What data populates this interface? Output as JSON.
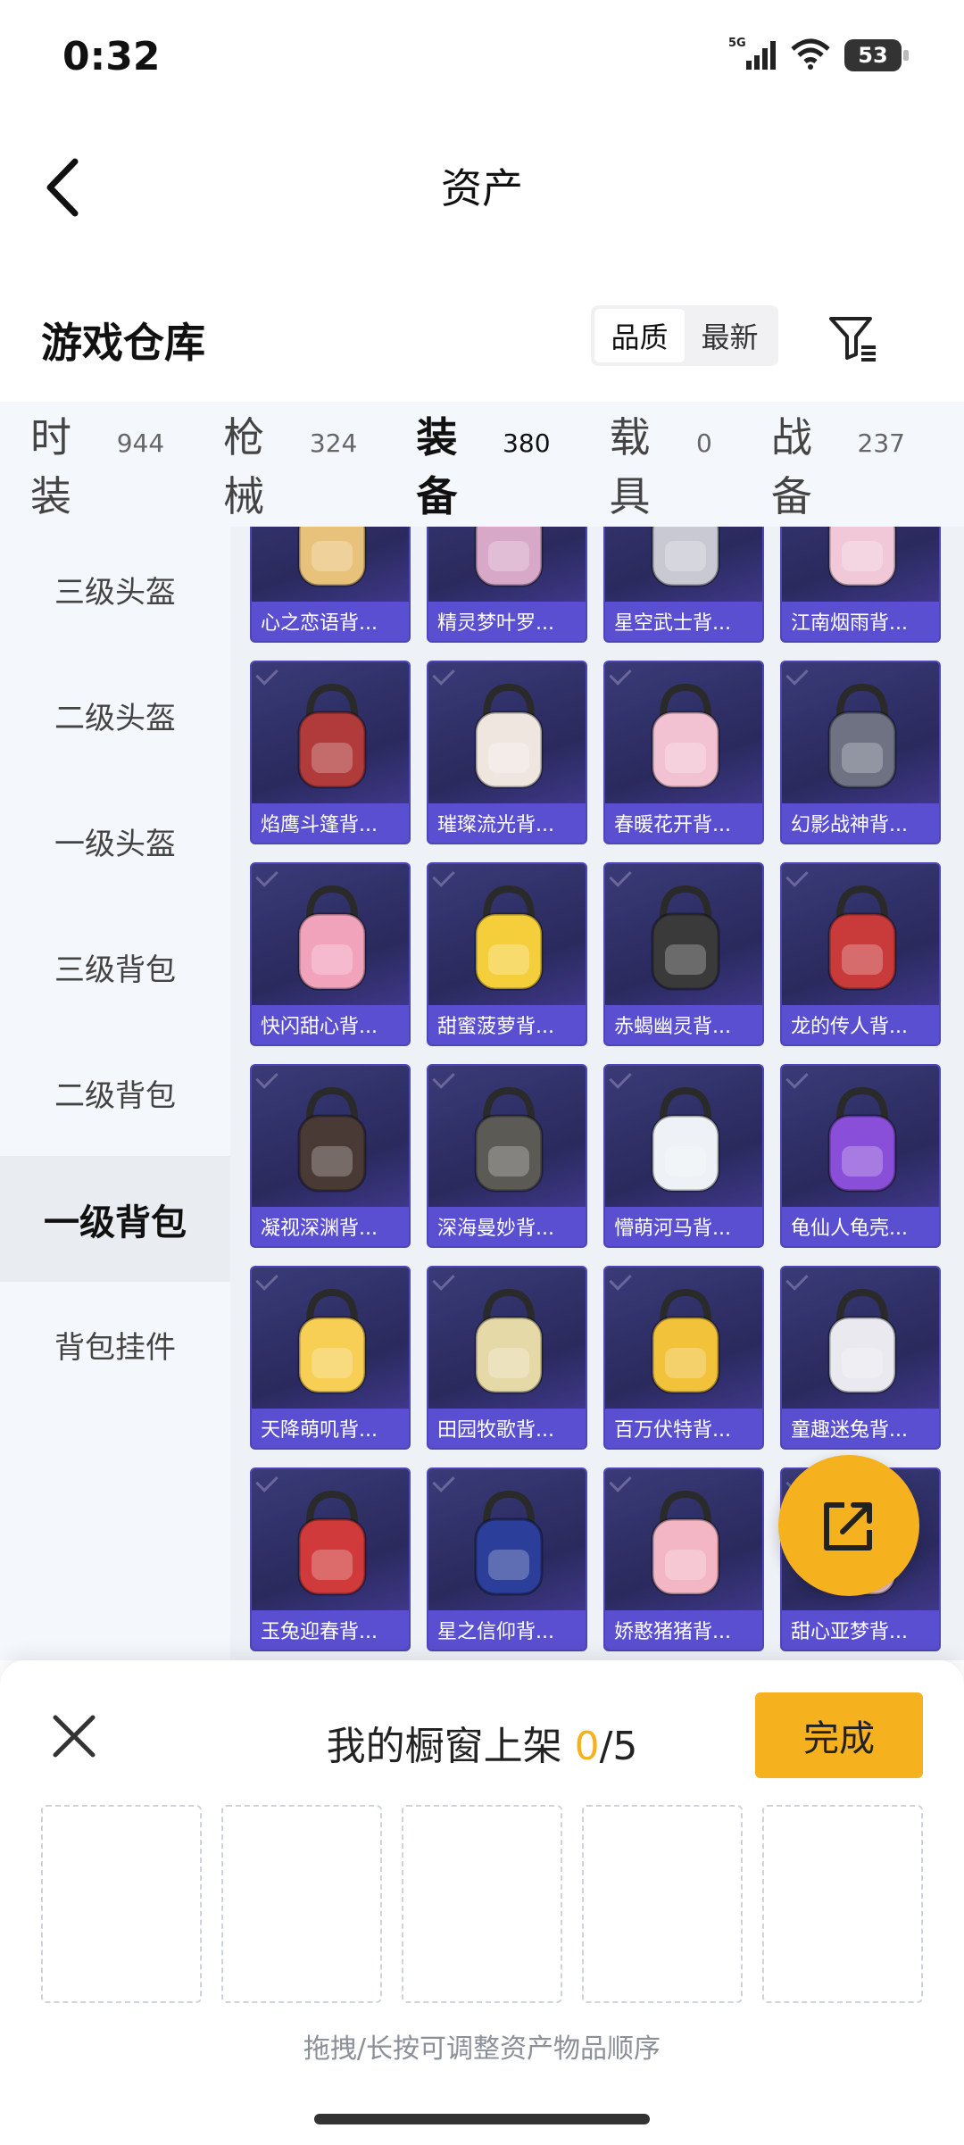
{
  "status_bar": {
    "time": "0:32",
    "network": "5G",
    "battery": "53"
  },
  "header": {
    "title": "资产"
  },
  "warehouse": {
    "title": "游戏仓库",
    "sort_options": [
      "品质",
      "最新"
    ],
    "active_sort": "品质"
  },
  "tabs": [
    {
      "name": "时装",
      "count": "944"
    },
    {
      "name": "枪械",
      "count": "324"
    },
    {
      "name": "装备",
      "count": "380",
      "active": true
    },
    {
      "name": "载具",
      "count": "0"
    },
    {
      "name": "战备",
      "count": "237"
    }
  ],
  "sidebar": {
    "items": [
      "三级头盔",
      "二级头盔",
      "一级头盔",
      "三级背包",
      "二级背包",
      "一级背包",
      "背包挂件"
    ],
    "active": "一级背包"
  },
  "items": [
    {
      "name": "心之恋语背...",
      "color": "#e8c27a"
    },
    {
      "name": "精灵梦叶罗...",
      "color": "#d7a8c8"
    },
    {
      "name": "星空武士背...",
      "color": "#c9c9d4"
    },
    {
      "name": "江南烟雨背...",
      "color": "#f0c8d8"
    },
    {
      "name": "焰鹰斗篷背...",
      "color": "#b13a3a"
    },
    {
      "name": "璀璨流光背...",
      "color": "#efe6e0"
    },
    {
      "name": "春暖花开背...",
      "color": "#f2c2d2"
    },
    {
      "name": "幻影战神背...",
      "color": "#6e7283"
    },
    {
      "name": "快闪甜心背...",
      "color": "#f2a3bc"
    },
    {
      "name": "甜蜜菠萝背...",
      "color": "#f5cf3b"
    },
    {
      "name": "赤蝎幽灵背...",
      "color": "#3a3a3a"
    },
    {
      "name": "龙的传人背...",
      "color": "#c93b3b"
    },
    {
      "name": "凝视深渊背...",
      "color": "#4a3a36"
    },
    {
      "name": "深海曼妙背...",
      "color": "#5c5a55"
    },
    {
      "name": "懵萌河马背...",
      "color": "#eef2f6"
    },
    {
      "name": "龟仙人龟壳...",
      "color": "#8a4fd8"
    },
    {
      "name": "天降萌叽背...",
      "color": "#f7cf55"
    },
    {
      "name": "田园牧歌背...",
      "color": "#e6d9a8"
    },
    {
      "name": "百万伏特背...",
      "color": "#f2c23a"
    },
    {
      "name": "童趣迷兔背...",
      "color": "#e9e9ef"
    },
    {
      "name": "玉兔迎春背...",
      "color": "#d13a3a"
    },
    {
      "name": "星之信仰背...",
      "color": "#2a3e9a"
    },
    {
      "name": "娇憨猪猪背...",
      "color": "#f3b6c4"
    },
    {
      "name": "甜心亚梦背...",
      "color": "#f2c6d6"
    }
  ],
  "panel": {
    "title": "我的橱窗上架",
    "used": "0",
    "total": "/5",
    "done_label": "完成",
    "hint": "拖拽/长按可调整资产物品顺序",
    "slot_count": 5
  }
}
